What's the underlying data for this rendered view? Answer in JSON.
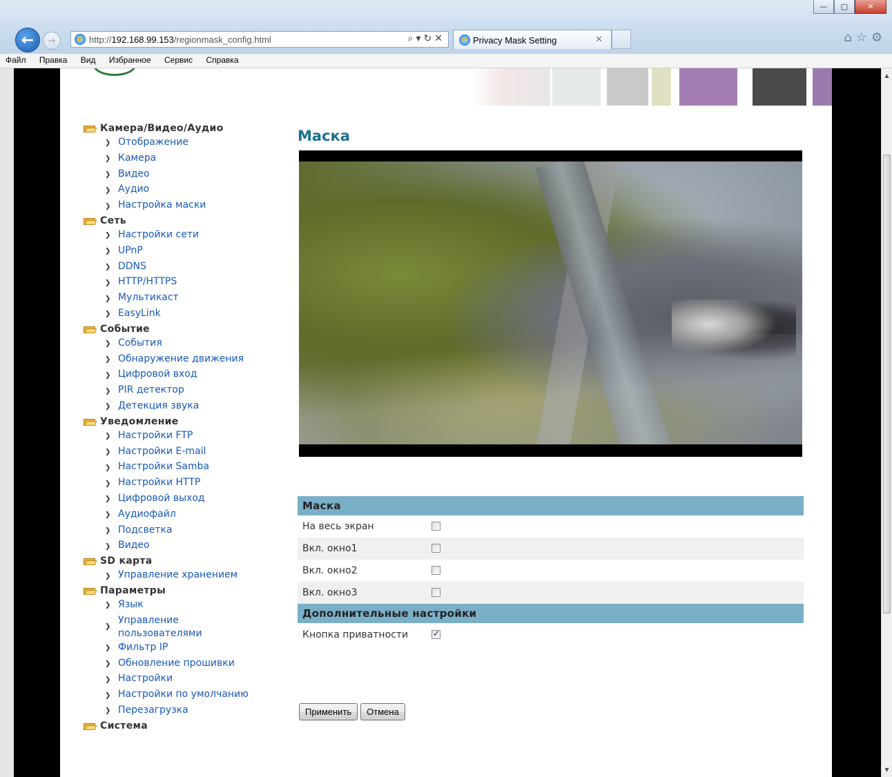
{
  "browser": {
    "url_prefix": "http://",
    "url_host": "192.168.99.153",
    "url_path": "/regionmask_config.html",
    "tab_title": "Privacy Mask Setting",
    "menu": [
      "Файл",
      "Правка",
      "Вид",
      "Избранное",
      "Сервис",
      "Справка"
    ]
  },
  "sidebar": {
    "groups": [
      {
        "title": "Камера/Видео/Аудио",
        "items": [
          "Отображение",
          "Камера",
          "Видео",
          "Аудио",
          "Настройка маски"
        ]
      },
      {
        "title": "Сеть",
        "items": [
          "Настройки сети",
          "UPnP",
          "DDNS",
          "HTTP/HTTPS",
          "Мультикаст",
          "EasyLink"
        ]
      },
      {
        "title": "Событие",
        "items": [
          "События",
          "Обнаружение движения",
          "Цифровой вход",
          "PIR детектор",
          "Детекция звука"
        ]
      },
      {
        "title": "Уведомление",
        "items": [
          "Настройки FTP",
          "Настройки E-mail",
          "Настройки Samba",
          "Настройки HTTP",
          "Цифровой выход",
          "Аудиофайл",
          "Подсветка",
          "Видео"
        ]
      },
      {
        "title": "SD карта",
        "items": [
          "Управление хранением"
        ]
      },
      {
        "title": "Параметры",
        "items": [
          "Язык",
          "Управление пользователями",
          "Фильтр IP",
          "Обновление прошивки",
          "Настройки",
          "Настройки по умолчанию",
          "Перезагрузка"
        ]
      },
      {
        "title": "Система",
        "items": []
      }
    ]
  },
  "main": {
    "title": "Маска",
    "mask_section_title": "Маска",
    "rows": [
      {
        "label": "На весь экран",
        "checked": false
      },
      {
        "label": "Вкл. окно1",
        "checked": false
      },
      {
        "label": "Вкл. окно2",
        "checked": false
      },
      {
        "label": "Вкл. окно3",
        "checked": false
      }
    ],
    "advanced_title": "Дополнительные настройки",
    "privacy_button_label": "Кнопка приватности",
    "privacy_button_checked": true,
    "apply_label": "Применить",
    "cancel_label": "Отмена"
  }
}
